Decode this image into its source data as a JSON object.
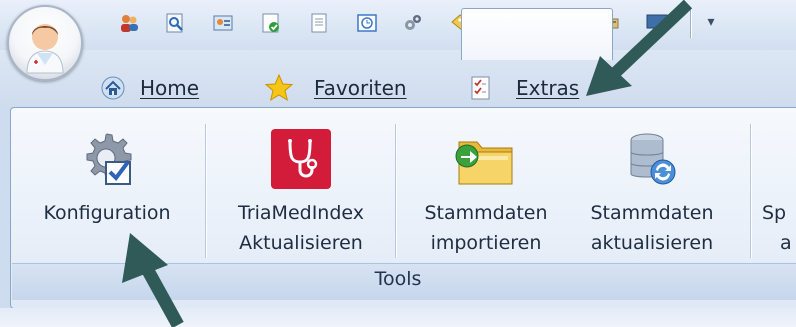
{
  "quick_access": {
    "icons": [
      "contacts-icon",
      "search-document-icon",
      "patient-card-icon",
      "checklist-icon",
      "document-icon",
      "calendar-icon",
      "gears-icon",
      "tag-icon",
      "download-icon",
      "heart-ecg-icon",
      "keyboard-icon",
      "monitor-icon"
    ],
    "dropdown_glyph": "▾"
  },
  "tabs": [
    {
      "label": "Home",
      "icon": "home-icon"
    },
    {
      "label": "Favoriten",
      "icon": "star-icon"
    },
    {
      "label": "Extras",
      "icon": "checklist-icon",
      "active": true
    }
  ],
  "ribbon": {
    "group_label": "Tools",
    "buttons": [
      {
        "line1": "Konfiguration",
        "line2": "",
        "icon": "gear-check-icon"
      },
      {
        "line1": "TriaMedIndex",
        "line2": "Aktualisieren",
        "icon": "stethoscope-icon"
      },
      {
        "line1": "Stammdaten",
        "line2": "importieren",
        "icon": "folder-import-icon"
      },
      {
        "line1": "Stammdaten",
        "line2": "aktualisieren",
        "icon": "database-refresh-icon"
      },
      {
        "line1": "Sp",
        "line2": "a",
        "icon": ""
      }
    ]
  },
  "colors": {
    "accent": "#8ba6c9",
    "arrow": "#2f5a57"
  }
}
